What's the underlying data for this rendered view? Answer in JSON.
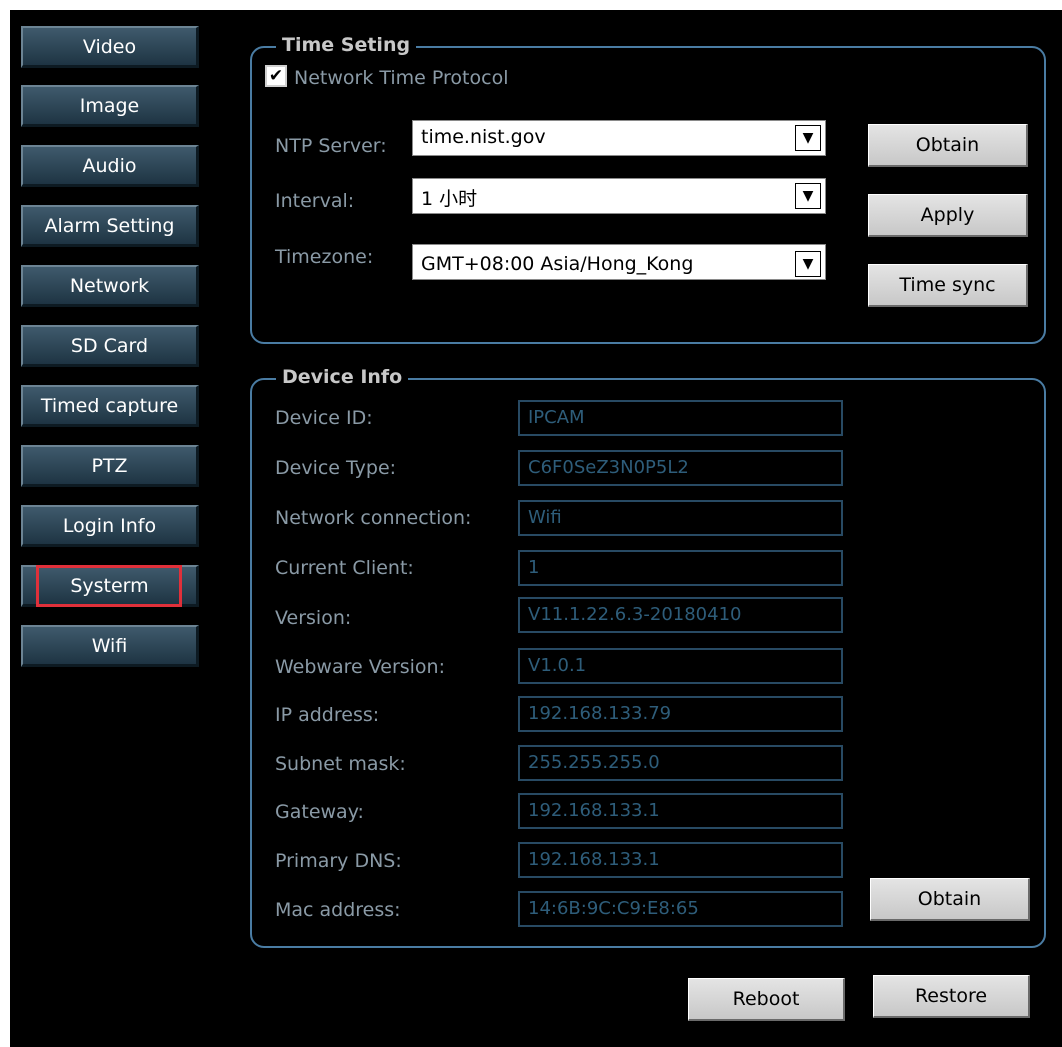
{
  "sidebar": {
    "items": [
      {
        "label": "Video"
      },
      {
        "label": "Image"
      },
      {
        "label": "Audio"
      },
      {
        "label": "Alarm Setting"
      },
      {
        "label": "Network"
      },
      {
        "label": "SD Card"
      },
      {
        "label": "Timed capture"
      },
      {
        "label": "PTZ"
      },
      {
        "label": "Login Info"
      },
      {
        "label": "Systerm"
      },
      {
        "label": "Wifi"
      }
    ],
    "selected": "Systerm"
  },
  "time_setting": {
    "legend": "Time Seting",
    "ntp_checkbox_label": "Network Time Protocol",
    "ntp_checked": "✔",
    "ntp_server_label": "NTP Server:",
    "ntp_server_value": "time.nist.gov",
    "interval_label": "Interval:",
    "interval_value": "1 小时",
    "timezone_label": "Timezone:",
    "timezone_value": "GMT+08:00 Asia/Hong_Kong",
    "obtain_label": "Obtain",
    "apply_label": "Apply",
    "time_sync_label": "Time sync"
  },
  "device_info": {
    "legend": "Device Info",
    "fields": [
      {
        "label": "Device ID:",
        "value": "IPCAM"
      },
      {
        "label": "Device Type:",
        "value": "C6F0SeZ3N0P5L2"
      },
      {
        "label": "Network connection:",
        "value": "Wifi"
      },
      {
        "label": "Current Client:",
        "value": "1"
      },
      {
        "label": "Version:",
        "value": "V11.1.22.6.3-20180410"
      },
      {
        "label": "Webware Version:",
        "value": "V1.0.1"
      },
      {
        "label": "IP address:",
        "value": "192.168.133.79"
      },
      {
        "label": "Subnet mask:",
        "value": "255.255.255.0"
      },
      {
        "label": "Gateway:",
        "value": "192.168.133.1"
      },
      {
        "label": "Primary DNS:",
        "value": "192.168.133.1"
      },
      {
        "label": "Mac address:",
        "value": "14:6B:9C:C9:E8:65"
      }
    ],
    "obtain_label": "Obtain"
  },
  "footer": {
    "reboot_label": "Reboot",
    "restore_label": "Restore"
  }
}
